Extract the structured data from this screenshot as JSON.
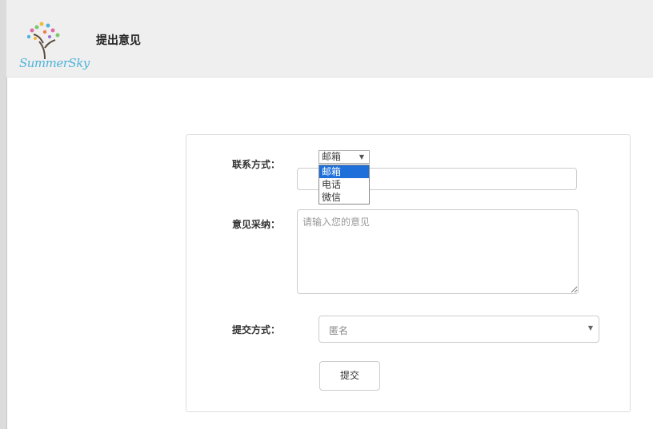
{
  "header": {
    "logo_text": "SummerSky",
    "title": "提出意见"
  },
  "form": {
    "contact": {
      "label": "联系方式：",
      "type_select_value": "邮箱",
      "type_options": [
        "邮箱",
        "电话",
        "微信"
      ],
      "selected_option": "邮箱",
      "input_value": ""
    },
    "opinion": {
      "label": "意见采纳：",
      "placeholder": "请输入您的意见",
      "value": ""
    },
    "submit_mode": {
      "label": "提交方式：",
      "value": "匿名"
    },
    "submit_label": "提交"
  },
  "colors": {
    "header_bg": "#efefef",
    "selected_option_bg": "#1e6fd9",
    "logo_text": "#4fb3d9"
  },
  "icons": {
    "dropdown_arrow": "▼"
  }
}
